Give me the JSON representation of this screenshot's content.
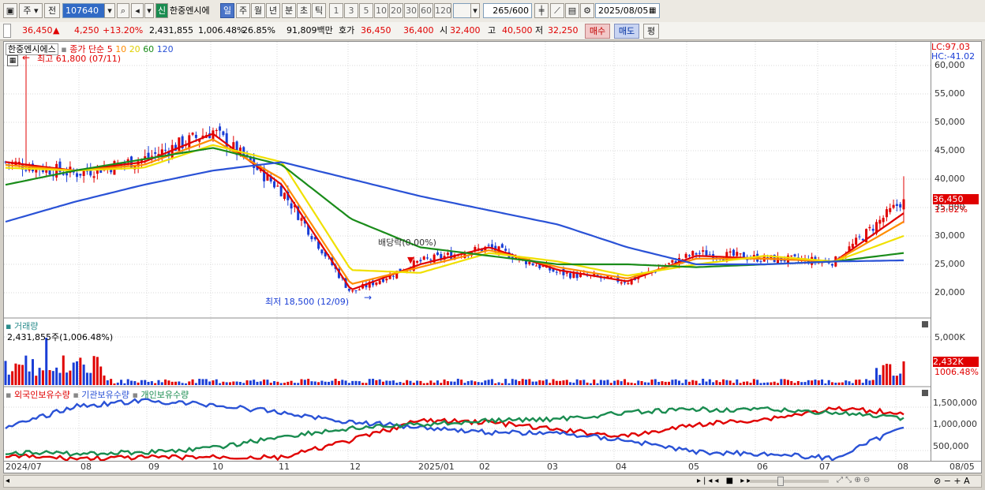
{
  "toolbar": {
    "interval_type": "주",
    "prev_label": "전",
    "code": "107640",
    "stock_badge": "신",
    "stock_name": "한중엔시에",
    "periods": [
      "일",
      "주",
      "월",
      "년",
      "분",
      "초",
      "틱"
    ],
    "active_period": "일",
    "minutes": [
      "1",
      "3",
      "5",
      "10",
      "20",
      "30",
      "60",
      "120"
    ],
    "count": "265",
    "count_total": "/600",
    "date": "2025/08/05"
  },
  "quote": {
    "price": "36,450",
    "change_arrow": "▲",
    "change": "4,250",
    "change_pct": "+13.20%",
    "volume": "2,431,855",
    "volume_ratio": "1,006.48%",
    "turnover": "26.85%",
    "amount": "91,809백만",
    "bid_label": "호가",
    "ask": "36,450",
    "bid": "36,400",
    "open_label": "시",
    "open": "32,400",
    "high_label": "고",
    "high": "40,500",
    "low_label": "저",
    "low": "32,250",
    "buy_label": "매수",
    "sell_label": "매도",
    "eval_label": "평"
  },
  "price_panel": {
    "name": "한중엔시에스",
    "ma_label": "종가 단순",
    "ma_periods": [
      "5",
      "10",
      "20",
      "60",
      "120"
    ],
    "ma_colors": [
      "#e00000",
      "#ff8c00",
      "#f0e000",
      "#1a8c1a",
      "#2a52d6"
    ],
    "max_label": "최고 61,800 (07/11)",
    "min_label": "최저 18,500 (12/09)",
    "dividend_label": "배당락(0.00%)",
    "lc": "LC:97.03",
    "hc": "HC:-41.02",
    "current_tag": "36,450",
    "current_pct": "13.02%",
    "y_ticks": [
      "60,000",
      "55,000",
      "50,000",
      "45,000",
      "40,000",
      "35,000",
      "30,000",
      "25,000",
      "20,000"
    ],
    "up_color": "#e00000",
    "down_color": "#1a3ed6"
  },
  "volume_panel": {
    "title": "거래량",
    "value": "2,431,855주(1,006.48%)",
    "y_tick": "5,000K",
    "current_tag": "2,432K",
    "current_pct": "1006.48%"
  },
  "holdings_panel": {
    "legend": [
      "외국인보유수량",
      "기관보유수량",
      "개인보유수량"
    ],
    "colors": [
      "#e00000",
      "#2a52d6",
      "#1a8c50"
    ],
    "y_ticks": [
      "1,500,000",
      "1,000,000",
      "500,000"
    ]
  },
  "x_labels": [
    "2024/07",
    "08",
    "09",
    "10",
    "11",
    "12",
    "2025/01",
    "02",
    "03",
    "04",
    "05",
    "06",
    "07",
    "08"
  ],
  "x_axis_end": "08/05",
  "chart_data": {
    "type": "candlestick",
    "title": "한중엔시에스",
    "x": [
      "2024/07",
      "08",
      "09",
      "10",
      "11",
      "12",
      "2025/01",
      "02",
      "03",
      "04",
      "05",
      "06",
      "07",
      "08"
    ],
    "close_approx": [
      43000,
      41000,
      43500,
      48500,
      38000,
      20000,
      25500,
      28000,
      23500,
      22000,
      27000,
      26000,
      25500,
      36450
    ],
    "high_point": {
      "date": "07/11",
      "value": 61800
    },
    "low_point": {
      "date": "12/09",
      "value": 18500
    },
    "ylim": [
      17000,
      62000
    ],
    "series": [
      {
        "name": "5",
        "values": [
          43000,
          41500,
          43000,
          48000,
          39000,
          20500,
          25000,
          28000,
          24000,
          22000,
          26500,
          26000,
          25500,
          34000
        ]
      },
      {
        "name": "10",
        "values": [
          42500,
          41500,
          42500,
          47000,
          40000,
          21500,
          24500,
          27500,
          24500,
          22500,
          26000,
          26000,
          25500,
          32500
        ]
      },
      {
        "name": "20",
        "values": [
          42000,
          41500,
          42000,
          46000,
          43000,
          24000,
          23500,
          27000,
          25500,
          23000,
          25000,
          26500,
          25500,
          30000
        ]
      },
      {
        "name": "60",
        "values": [
          39000,
          41500,
          43500,
          45500,
          42500,
          33000,
          28000,
          26500,
          25000,
          25000,
          24500,
          25000,
          25500,
          27000
        ]
      },
      {
        "name": "120",
        "values": [
          32500,
          36000,
          39000,
          41500,
          43000,
          40000,
          37000,
          34500,
          32000,
          28000,
          25000,
          25000,
          25500,
          25700
        ]
      }
    ]
  }
}
